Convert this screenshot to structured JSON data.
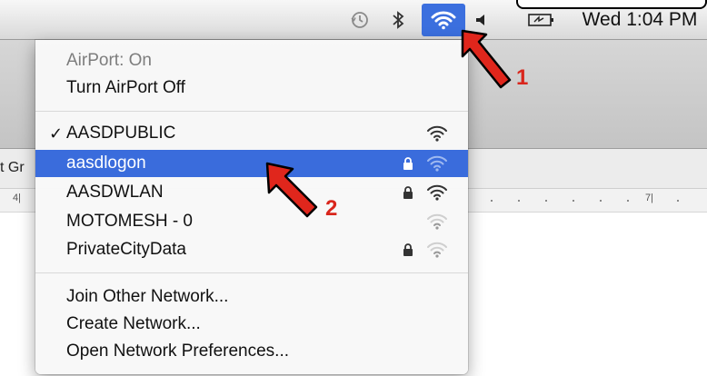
{
  "menubar": {
    "icons": [
      "time-machine-icon",
      "bluetooth-icon",
      "wifi-icon",
      "volume-icon",
      "battery-icon"
    ],
    "clock": "Wed 1:04 PM",
    "wifi_active_color": "#3b6fde"
  },
  "background_app": {
    "toolbar_label": "t Gr",
    "ruler_numbers": [
      "4|",
      "7|"
    ]
  },
  "airport_menu": {
    "status": "AirPort: On",
    "toggle": "Turn AirPort Off",
    "networks": [
      {
        "name": "AASDPUBLIC",
        "checked": true,
        "locked": false,
        "selected": false,
        "signal": "strong"
      },
      {
        "name": "aasdlogon",
        "checked": false,
        "locked": true,
        "selected": true,
        "signal": "strong"
      },
      {
        "name": "AASDWLAN",
        "checked": false,
        "locked": true,
        "selected": false,
        "signal": "strong"
      },
      {
        "name": "MOTOMESH - 0",
        "checked": false,
        "locked": false,
        "selected": false,
        "signal": "weak"
      },
      {
        "name": "PrivateCityData",
        "checked": false,
        "locked": true,
        "selected": false,
        "signal": "weak"
      }
    ],
    "actions": [
      "Join Other Network...",
      "Create Network...",
      "Open Network Preferences..."
    ],
    "highlight_color": "#3a6cdc"
  },
  "annotations": {
    "arrow1_label": "1",
    "arrow2_label": "2",
    "arrow_color": "#d9261c"
  }
}
